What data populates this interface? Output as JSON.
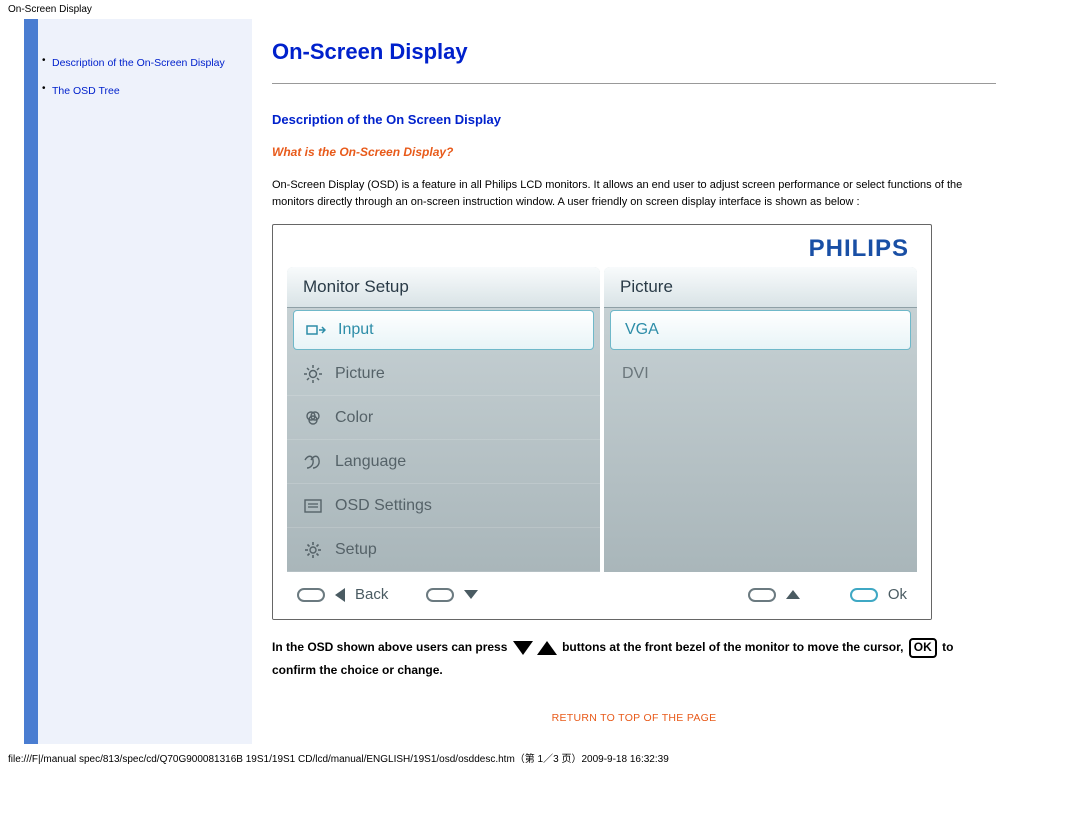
{
  "header": {
    "title": "On-Screen Display"
  },
  "sidebar": {
    "items": [
      {
        "label": "Description of the On-Screen Display"
      },
      {
        "label": "The OSD Tree"
      }
    ]
  },
  "main": {
    "h1": "On-Screen Display",
    "h2": "Description of the On Screen Display",
    "h3": "What is the On-Screen Display?",
    "paragraph": "On-Screen Display (OSD) is a feature in all Philips LCD monitors. It allows an end user to adjust screen performance or select functions of the monitors directly through an on-screen instruction window. A user friendly on screen display interface is shown as below :"
  },
  "osd": {
    "brand": "PHILIPS",
    "left_header": "Monitor Setup",
    "right_header": "Picture",
    "left_items": [
      {
        "label": "Input",
        "selected": true
      },
      {
        "label": "Picture",
        "selected": false
      },
      {
        "label": "Color",
        "selected": false
      },
      {
        "label": "Language",
        "selected": false
      },
      {
        "label": "OSD Settings",
        "selected": false
      },
      {
        "label": "Setup",
        "selected": false
      }
    ],
    "right_items": [
      {
        "label": "VGA",
        "selected": true
      },
      {
        "label": "DVI",
        "selected": false
      }
    ],
    "footer": {
      "back": "Back",
      "ok": "Ok"
    }
  },
  "instruction": {
    "part1": "In the OSD shown above users can press",
    "part2": "buttons at the front bezel of the monitor to move the cursor,",
    "ok_label": "OK",
    "part3": "to confirm the choice or change."
  },
  "return_link": "RETURN TO TOP OF THE PAGE",
  "footer_path": "file:///F|/manual spec/813/spec/cd/Q70G900081316B 19S1/19S1 CD/lcd/manual/ENGLISH/19S1/osd/osddesc.htm（第 1／3 页）2009-9-18 16:32:39"
}
